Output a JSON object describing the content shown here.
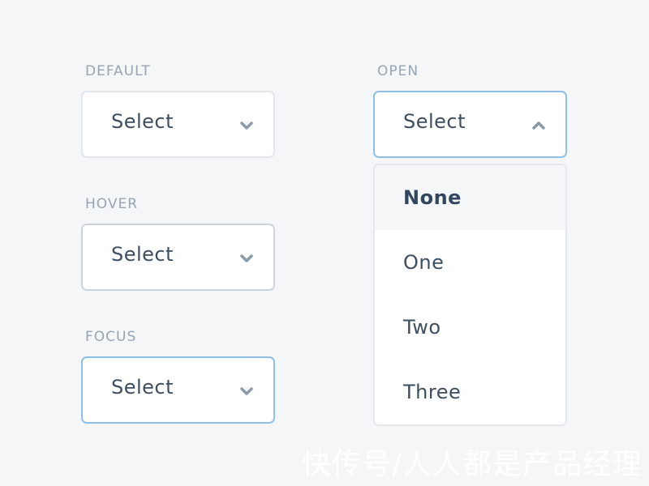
{
  "states": {
    "default": {
      "label": "DEFAULT",
      "value": "Select",
      "icon": "chevron-down-icon"
    },
    "hover": {
      "label": "HOVER",
      "value": "Select",
      "icon": "chevron-down-icon"
    },
    "focus": {
      "label": "FOCUS",
      "value": "Select",
      "icon": "chevron-down-icon"
    },
    "open": {
      "label": "OPEN",
      "value": "Select",
      "icon": "chevron-up-icon"
    }
  },
  "menu": {
    "options": [
      {
        "label": "None",
        "selected": true
      },
      {
        "label": "One"
      },
      {
        "label": "Two"
      },
      {
        "label": "Three"
      }
    ]
  },
  "watermark": "快传号/人人都是产品经理",
  "colors": {
    "background": "#f4f6f8",
    "label": "#97a4b2",
    "text": "#3d4e60",
    "focus_border": "#8fbfe5",
    "chevron": "#8a99a8"
  }
}
